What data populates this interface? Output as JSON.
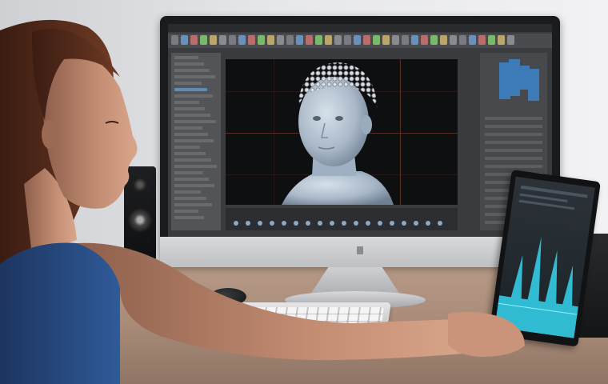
{
  "scene": {
    "description_tags": [
      "woman",
      "desktop-monitor",
      "3d-modeling-software",
      "keyboard",
      "mouse",
      "speakers",
      "tablet"
    ]
  },
  "colors": {
    "wall": "#e6e7ea",
    "desk": "#a88b78",
    "monitor_frame": "#1a1b1d",
    "viewport_bg": "#0e0f11",
    "grid_line": "#5a2e22",
    "head_model": "#b9c7d6",
    "tablet_glow": "#35d6f0",
    "top_color": "#2a4f8a",
    "skin": "#c48e74",
    "hair": "#5a2e1e"
  },
  "icons": {
    "toolbar": "tool-icon",
    "speaker": "speaker-icon",
    "monitor_logo": "logo-icon"
  }
}
